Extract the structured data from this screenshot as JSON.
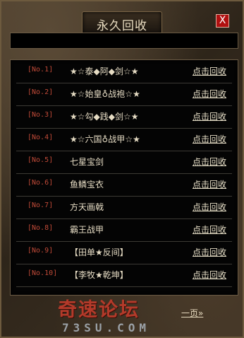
{
  "window": {
    "title": "永久回收",
    "close_label": "X"
  },
  "rows": [
    {
      "num": "[No.1]",
      "name": "★☆泰◆阿◆剑☆★",
      "action": "点击回收"
    },
    {
      "num": "[No.2]",
      "name": "★☆始皇♁战袍☆★",
      "action": "点击回收"
    },
    {
      "num": "[No.3]",
      "name": "★☆勾◆践◆剑☆★",
      "action": "点击回收"
    },
    {
      "num": "[No.4]",
      "name": "★☆六国♁战甲☆★",
      "action": "点击回收"
    },
    {
      "num": "[No.5]",
      "name": "七星宝剑",
      "action": "点击回收"
    },
    {
      "num": "[No.6]",
      "name": "鱼鳞宝衣",
      "action": "点击回收"
    },
    {
      "num": "[No.7]",
      "name": "方天画戟",
      "action": "点击回收"
    },
    {
      "num": "[No.8]",
      "name": "霸王战甲",
      "action": "点击回收"
    },
    {
      "num": "[No.9]",
      "name": "【田单★反间】",
      "action": "点击回收"
    },
    {
      "num": "[No.10]",
      "name": "【李牧★乾坤】",
      "action": "点击回收"
    }
  ],
  "pagination": {
    "next_label": "一页»"
  },
  "watermark": {
    "text": "奇速论坛",
    "sub": "73SU.COM"
  }
}
